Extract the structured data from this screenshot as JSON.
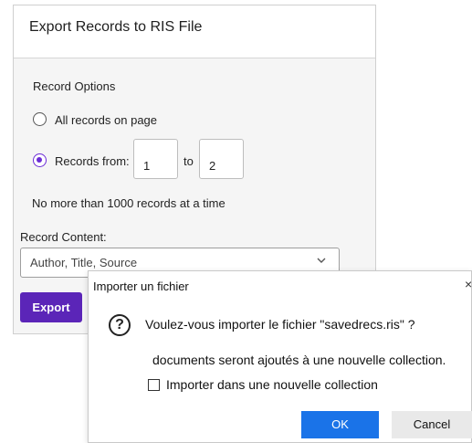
{
  "export_panel": {
    "title": "Export Records to RIS File",
    "record_options_label": "Record Options",
    "option_all": "All records on page",
    "option_range": "Records from:",
    "range_from": "1",
    "range_to_label": "to",
    "range_to": "2",
    "limit_note": "No more than 1000 records at a time",
    "record_content_label": "Record Content:",
    "record_content_value": "Author, Title, Source",
    "export_button": "Export",
    "selected_option": "range",
    "accent_color": "#5b25b8"
  },
  "import_dialog": {
    "title": "Importer un fichier",
    "close_glyph": "×",
    "question_glyph": "?",
    "message": "Voulez-vous importer le fichier \"savedrecs.ris\" ?",
    "message2": "documents seront ajoutés à une nouvelle collection.",
    "checkbox_label": "Importer dans une nouvelle collection",
    "checkbox_checked": false,
    "ok_button": "OK",
    "cancel_button": "Cancel",
    "ok_color": "#1a73e8"
  }
}
